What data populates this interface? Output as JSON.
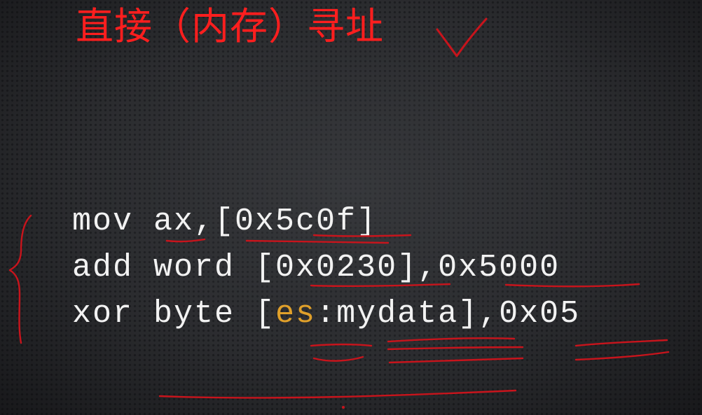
{
  "slide": {
    "title": "直接（内存）寻址",
    "code_lines": [
      [
        {
          "text": "mov ax,[0x5c0f]",
          "role": "plain"
        }
      ],
      [
        {
          "text": "add word [0x0230],0x5000",
          "role": "plain"
        }
      ],
      [
        {
          "text": "xor byte [",
          "role": "plain"
        },
        {
          "text": "es",
          "role": "segment"
        },
        {
          "text": ":mydata],0x05",
          "role": "plain"
        }
      ]
    ]
  },
  "colors": {
    "background": "#2b2c2f",
    "title": "#ff1e1e",
    "code_text": "#f2f2f2",
    "segment_register": "#e0a02a",
    "annotation_ink": "#c8141c"
  },
  "annotations": {
    "checkmark": true,
    "left_brace": true,
    "underlines": true
  }
}
